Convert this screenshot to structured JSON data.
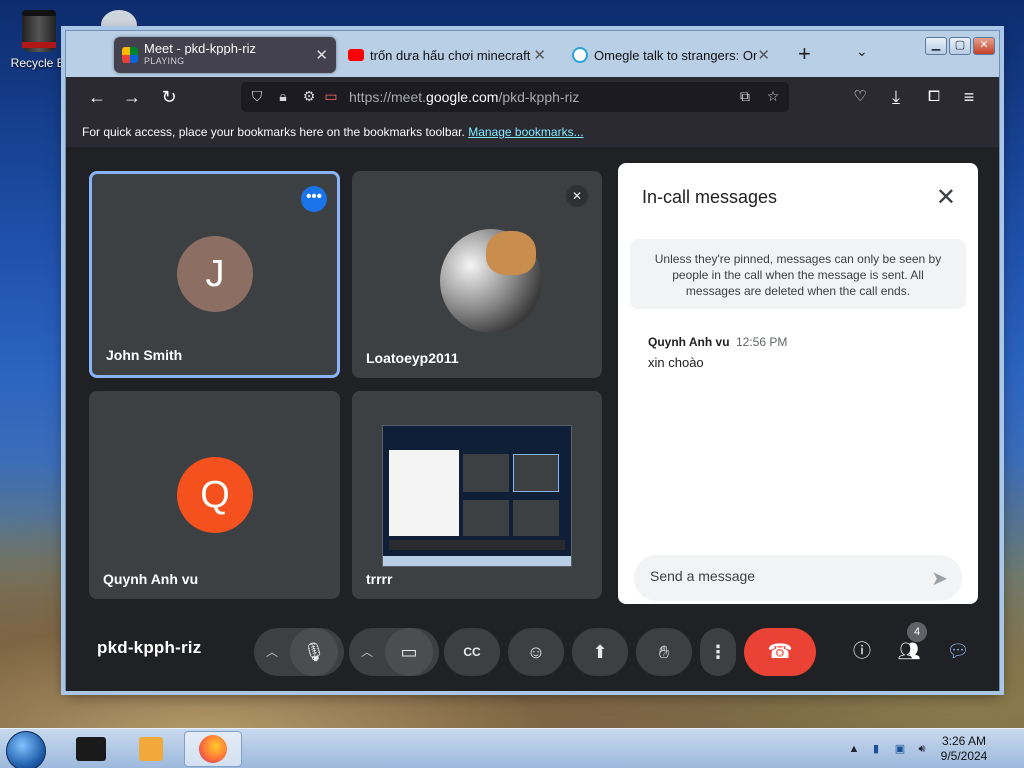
{
  "desktop": {
    "recycle_bin_label": "Recycle Bi"
  },
  "browser": {
    "tabs": [
      {
        "title": "Meet - pkd-kpph-riz",
        "subtitle": "PLAYING",
        "favicon": "google-meet-icon"
      },
      {
        "title": "trốn dưa hấu chơi minecraft - Y",
        "favicon": "youtube-icon"
      },
      {
        "title": "Omegle talk to strangers: Omeg",
        "favicon": "omegle-icon"
      }
    ],
    "new_tab_label": "+",
    "url_prefix": "https://meet.",
    "url_domain": "google.com",
    "url_path": "/pkd-kpph-riz",
    "bookmarks_text": "For quick access, place your bookmarks here on the bookmarks toolbar.",
    "bookmarks_link": "Manage bookmarks..."
  },
  "meet": {
    "participants": [
      {
        "name": "John Smith",
        "initial": "J",
        "avatar_color": "#8d6e63",
        "speaking": true
      },
      {
        "name": "Loatoeyp2011",
        "muted": true
      },
      {
        "name": "Quynh Anh vu",
        "initial": "Q",
        "avatar_color": "#f4511e"
      },
      {
        "name": "trrrr",
        "presenting": true
      }
    ],
    "panel": {
      "title": "In-call messages",
      "notice": "Unless they're pinned, messages can only be seen by people in the call when the message is sent. All messages are deleted when the call ends.",
      "messages": [
        {
          "sender": "Quynh Anh vu",
          "time": "12:56 PM",
          "text": "xin choào"
        }
      ],
      "compose_placeholder": "Send a message"
    },
    "meeting_code": "pkd-kpph-riz",
    "people_count": "4",
    "colors": {
      "accent": "#1a73e8",
      "end_call": "#ea4335",
      "tile_bg": "#3c4043",
      "page_bg": "#202124"
    }
  },
  "taskbar": {
    "time": "3:26 AM",
    "date": "9/5/2024"
  }
}
